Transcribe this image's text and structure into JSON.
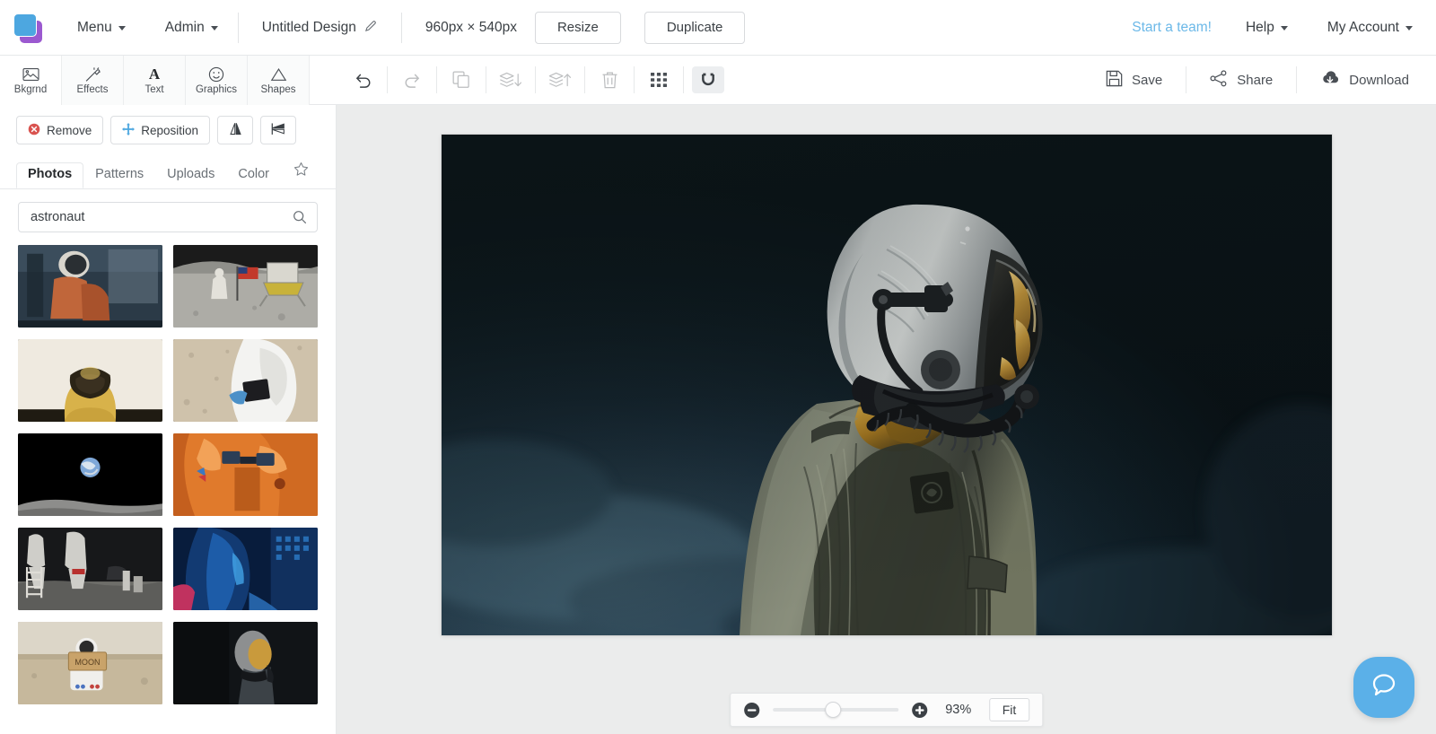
{
  "topbar": {
    "logo_colors": {
      "front": "#4da7e0",
      "back": "#9b59d0"
    },
    "menu_label": "Menu",
    "admin_label": "Admin",
    "design_title": "Untitled Design",
    "edit_icon": "pencil-icon",
    "dimensions": "960px × 540px",
    "resize_label": "Resize",
    "duplicate_label": "Duplicate",
    "start_team_label": "Start a team!",
    "start_team_color": "#6bb8e8",
    "help_label": "Help",
    "account_label": "My Account"
  },
  "toolbar": {
    "tabs": [
      {
        "label": "Bkgrnd",
        "icon": "image-icon",
        "active": true
      },
      {
        "label": "Effects",
        "icon": "magic-wand-icon",
        "active": false
      },
      {
        "label": "Text",
        "icon": "letter-a-icon",
        "active": false
      },
      {
        "label": "Graphics",
        "icon": "smiley-icon",
        "active": false
      },
      {
        "label": "Shapes",
        "icon": "triangle-icon",
        "active": false
      }
    ],
    "actions": [
      {
        "name": "undo-button",
        "icon": "undo-icon",
        "disabled": false
      },
      {
        "name": "redo-button",
        "icon": "redo-icon",
        "disabled": true
      },
      {
        "name": "duplicate-layer-button",
        "icon": "copy-icon",
        "disabled": true
      },
      {
        "name": "send-backward-button",
        "icon": "layers-down-icon",
        "disabled": true
      },
      {
        "name": "bring-forward-button",
        "icon": "layers-up-icon",
        "disabled": true
      },
      {
        "name": "delete-button",
        "icon": "trash-icon",
        "disabled": true
      },
      {
        "name": "grid-button",
        "icon": "grid-icon",
        "disabled": false
      },
      {
        "name": "snap-magnet-button",
        "icon": "magnet-icon",
        "disabled": false,
        "active": true
      }
    ],
    "save_label": "Save",
    "share_label": "Share",
    "download_label": "Download"
  },
  "sidebar": {
    "bg_actions": [
      {
        "label": "Remove",
        "icon": "remove-circle-icon",
        "accent": "#d9534f"
      },
      {
        "label": "Reposition",
        "icon": "move-arrows-icon",
        "accent": "#4da7e0"
      },
      {
        "label": "",
        "icon": "flip-horizontal-icon",
        "accent": "#3b4045"
      },
      {
        "label": "",
        "icon": "flip-vertical-icon",
        "accent": "#3b4045"
      }
    ],
    "tabs": [
      {
        "label": "Photos",
        "active": true
      },
      {
        "label": "Patterns",
        "active": false
      },
      {
        "label": "Uploads",
        "active": false
      },
      {
        "label": "Color",
        "active": false
      }
    ],
    "favorites_icon": "star-icon",
    "search": {
      "value": "astronaut",
      "placeholder": "Search",
      "icon": "search-icon"
    },
    "thumbnails": [
      {
        "id": "thumb-1",
        "alt": "astronaut suiting up in workshop",
        "palette": [
          "#2a3a4a",
          "#c0663a",
          "#e8e4dc"
        ]
      },
      {
        "id": "thumb-2",
        "alt": "apollo astronaut saluting flag on moon",
        "palette": [
          "#9a9a98",
          "#c3c3bf",
          "#2a2a2a"
        ]
      },
      {
        "id": "thumb-3",
        "alt": "gold reflective space helmet bust",
        "palette": [
          "#d8b24a",
          "#f2ecdf",
          "#2b2416"
        ]
      },
      {
        "id": "thumb-4",
        "alt": "person in white hazmat suit with tablet",
        "palette": [
          "#d8cab5",
          "#f2f2f0",
          "#4b90c8"
        ]
      },
      {
        "id": "thumb-5",
        "alt": "earthrise over lunar horizon",
        "palette": [
          "#000000",
          "#7fa8d8",
          "#8d8d8b"
        ]
      },
      {
        "id": "thumb-6",
        "alt": "orange pressure suit close-up",
        "palette": [
          "#e07a2c",
          "#f2a258",
          "#7a2b12"
        ]
      },
      {
        "id": "thumb-7",
        "alt": "astronauts descending lunar module ladder",
        "palette": [
          "#1a1a1a",
          "#c9c9c5",
          "#6e6e6a"
        ]
      },
      {
        "id": "thumb-8",
        "alt": "blue neon lit figure",
        "palette": [
          "#0d2f63",
          "#2f86d8",
          "#c0325f"
        ]
      },
      {
        "id": "thumb-9",
        "alt": "astronaut holding MOON cardboard sign in desert",
        "palette": [
          "#cfc4b0",
          "#f0efec",
          "#b29a6b"
        ]
      },
      {
        "id": "thumb-10",
        "alt": "dark portrait of astronaut helmet",
        "palette": [
          "#111417",
          "#8d8f90",
          "#3c4247"
        ]
      }
    ]
  },
  "canvas": {
    "image_alt": "astronaut wearing silver flight helmet and olive coverall on dark teal background",
    "background_colors": {
      "top": "#0c1518",
      "bottom_left_glow": "#2c4450",
      "deep": "#060b0d"
    },
    "subject_colors": {
      "helmet": "#b9bdbd",
      "visor": "#c89a3f",
      "coverall": "#4d5040",
      "hose": "#15171a"
    }
  },
  "zoombar": {
    "zoom_out_icon": "minus-circle-icon",
    "zoom_in_icon": "plus-circle-icon",
    "zoom_percent": "93%",
    "slider_position_pct": 48,
    "fit_label": "Fit"
  },
  "chat": {
    "icon": "chat-bubble-icon",
    "color": "#5bb0e8"
  }
}
